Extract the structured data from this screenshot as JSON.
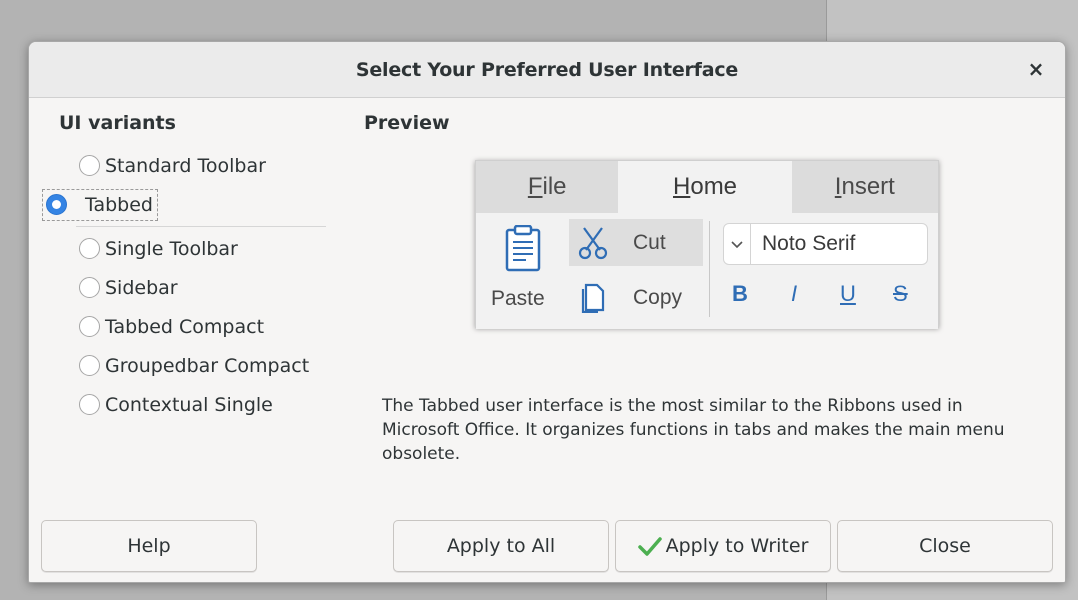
{
  "dialog": {
    "title": "Select Your Preferred User Interface",
    "close_glyph": "×"
  },
  "left": {
    "heading": "UI variants",
    "options": [
      {
        "label": "Standard Toolbar",
        "checked": false
      },
      {
        "label": "Tabbed",
        "checked": true
      },
      {
        "label": "Single Toolbar",
        "checked": false
      },
      {
        "label": "Sidebar",
        "checked": false
      },
      {
        "label": "Tabbed Compact",
        "checked": false
      },
      {
        "label": "Groupedbar Compact",
        "checked": false
      },
      {
        "label": "Contextual Single",
        "checked": false
      }
    ]
  },
  "right": {
    "heading": "Preview",
    "preview": {
      "tabs": [
        {
          "label": "File",
          "accel": "F",
          "rest": "ile"
        },
        {
          "label": "Home",
          "accel": "H",
          "rest": "ome"
        },
        {
          "label": "Insert",
          "accel": "I",
          "rest": "nsert"
        }
      ],
      "paste": "Paste",
      "cut": "Cut",
      "copy": "Copy",
      "font": "Noto Serif",
      "bold": "B",
      "italic": "I",
      "underline": "U",
      "strike": "S"
    },
    "description": "The Tabbed user interface is the most similar to the Ribbons used in Microsoft Office. It organizes functions in tabs and makes the main menu obsolete."
  },
  "buttons": {
    "help": "Help",
    "apply_all": "Apply to All",
    "apply_writer": "Apply to Writer",
    "close": "Close"
  },
  "colors": {
    "accent": "#3584e4",
    "check": "#4caf50",
    "format_blue": "#2f6db5"
  }
}
